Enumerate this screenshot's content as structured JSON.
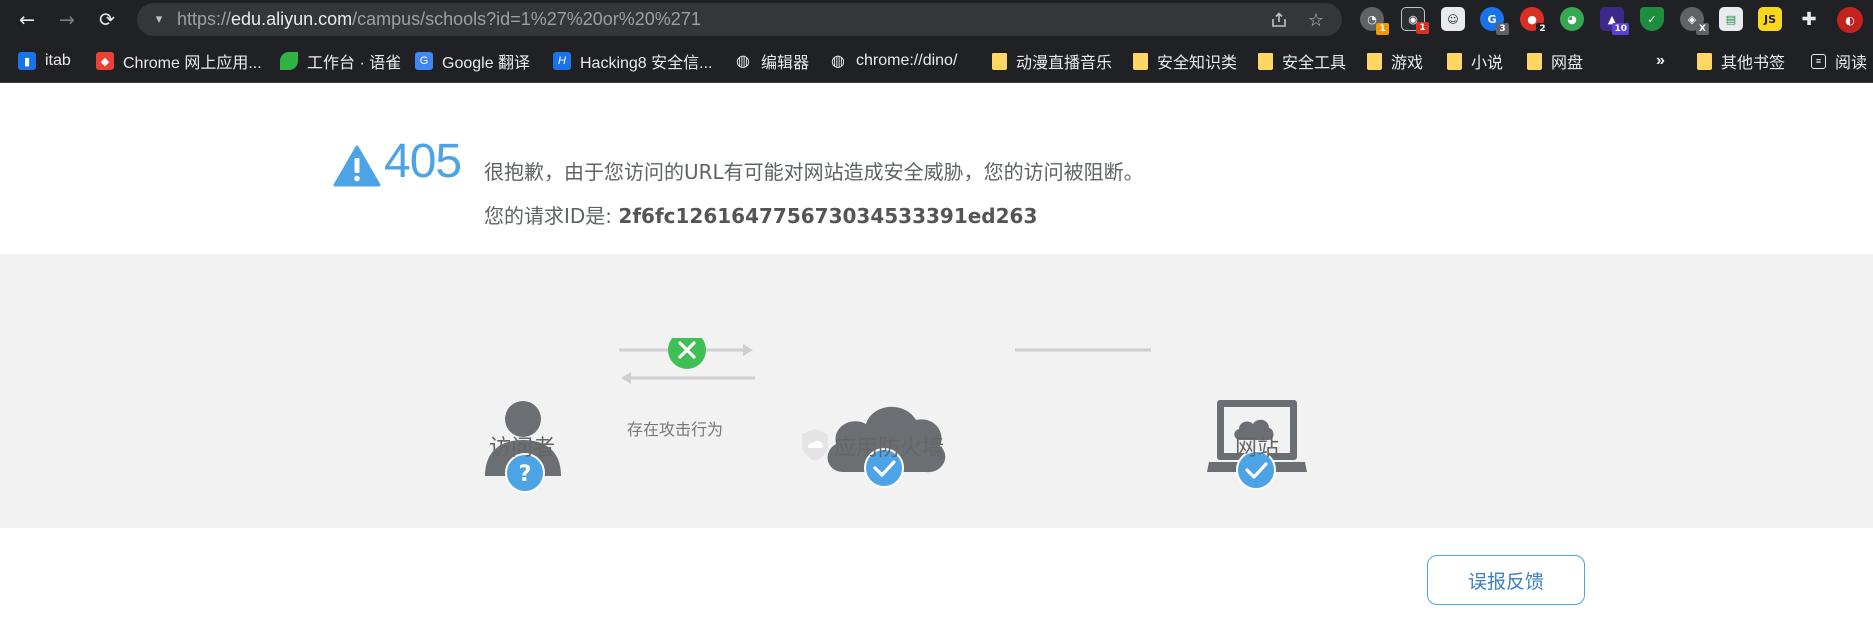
{
  "browser": {
    "url_prefix": "https://",
    "url_host": "edu.aliyun.com",
    "url_path": "/campus/schools?id=1%27%20or%20%271",
    "extensions": [
      {
        "icon": "extension-1-icon",
        "badge": "1",
        "badge_color": "#f29900"
      },
      {
        "icon": "extension-2-icon",
        "badge": "1",
        "badge_color": "#d93025"
      },
      {
        "icon": "extension-3-icon",
        "badge": ""
      },
      {
        "icon": "extension-4-icon",
        "badge": "3",
        "badge_color": "#5f6368"
      },
      {
        "icon": "extension-5-icon",
        "badge": "2",
        "badge_color": "#202124"
      },
      {
        "icon": "extension-6-icon",
        "badge": ""
      },
      {
        "icon": "extension-7-icon",
        "badge": "10",
        "badge_color": "#5b3fd6"
      },
      {
        "icon": "extension-8-icon",
        "badge": ""
      },
      {
        "icon": "extension-9-icon",
        "badge": "X",
        "badge_color": "#5f6368"
      },
      {
        "icon": "extension-10-icon",
        "badge": ""
      },
      {
        "icon": "extension-11-icon",
        "badge": ""
      },
      {
        "icon": "puzzle-icon",
        "badge": ""
      },
      {
        "icon": "profile-avatar-icon",
        "badge": ""
      }
    ]
  },
  "bookmarks": {
    "items": [
      {
        "label": "itab",
        "icon": "itab-icon"
      },
      {
        "label": "Chrome 网上应用...",
        "icon": "chrome-webstore-icon"
      },
      {
        "label": "工作台 · 语雀",
        "icon": "yuque-icon"
      },
      {
        "label": "Google 翻译",
        "icon": "google-translate-icon"
      },
      {
        "label": "Hacking8 安全信...",
        "icon": "hacking8-icon"
      },
      {
        "label": "编辑器",
        "icon": "globe-icon"
      },
      {
        "label": "chrome://dino/",
        "icon": "globe-icon"
      },
      {
        "label": "动漫直播音乐",
        "icon": "folder-icon"
      },
      {
        "label": "安全知识类",
        "icon": "folder-icon"
      },
      {
        "label": "安全工具",
        "icon": "folder-icon"
      },
      {
        "label": "游戏",
        "icon": "folder-icon"
      },
      {
        "label": "小说",
        "icon": "folder-icon"
      },
      {
        "label": "网盘",
        "icon": "folder-icon"
      }
    ],
    "overflow": "»",
    "other": "其他书签",
    "reading": "阅读"
  },
  "error": {
    "code": "405",
    "message": "很抱歉，由于您访问的URL有可能对网站造成安全威胁，您的访问被阻断。",
    "request_id_label": "您的请求ID是: ",
    "request_id": "2f6fc126164775673034533391ed263"
  },
  "diagram": {
    "visitor_label": "访问者",
    "attack_label": "存在攻击行为",
    "firewall_label": "应用防火墙",
    "website_label": "网站"
  },
  "feedback_button": "误报反馈",
  "colors": {
    "accent_blue": "#4ca3e6",
    "node_gray": "#6b6f73",
    "block_green": "#3fbf55",
    "band_bg": "#f2f2f2"
  }
}
